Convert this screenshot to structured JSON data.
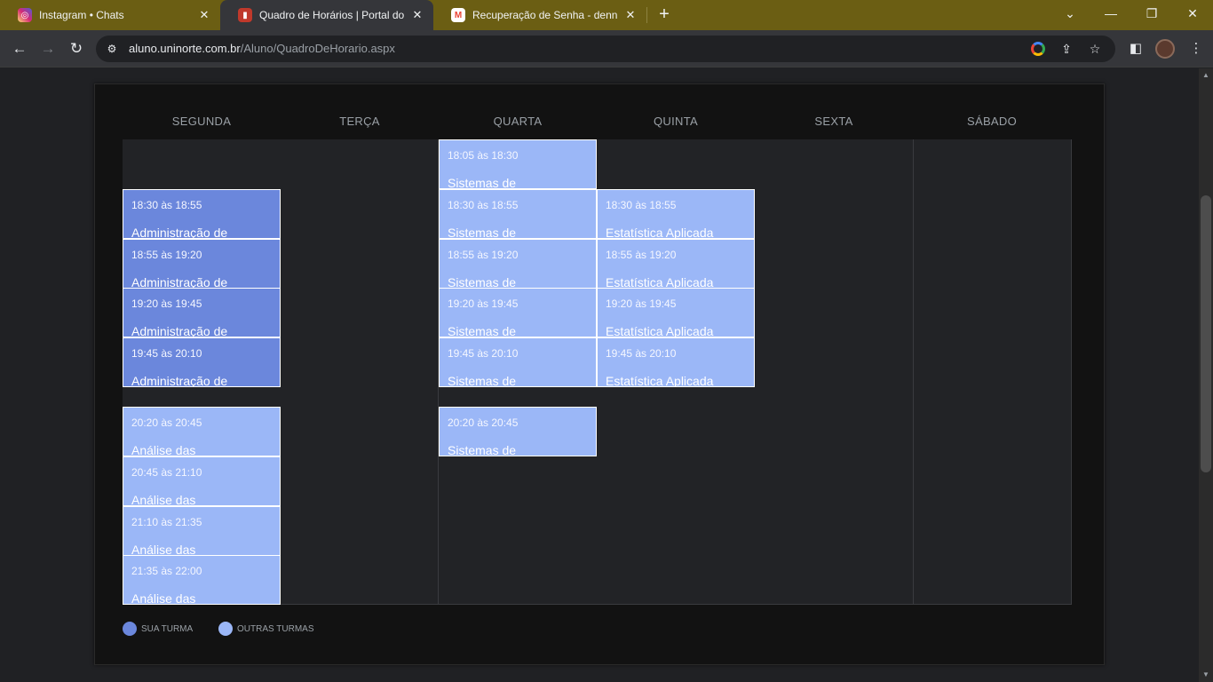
{
  "browser": {
    "tabs": [
      {
        "title": "Instagram • Chats",
        "icon": "instagram-icon"
      },
      {
        "title": "Quadro de Horários | Portal do Al",
        "icon": "uninorte-icon"
      },
      {
        "title": "Recuperação de Senha - dennelly",
        "icon": "gmail-icon"
      }
    ],
    "close_glyph": "✕",
    "new_tab_glyph": "+",
    "url_domain": "aluno.uninorte.com.br",
    "url_path": "/Aluno/QuadroDeHorario.aspx",
    "window_controls": {
      "dropdown": "⌄",
      "minimize": "—",
      "restore": "❐",
      "close": "✕"
    }
  },
  "schedule": {
    "days": [
      "SEGUNDA",
      "TERÇA",
      "QUARTA",
      "QUINTA",
      "SEXTA",
      "SÁBADO"
    ],
    "monday": [
      {
        "time": "18:30 às 18:55",
        "subject": "Administração de",
        "type": "mine"
      },
      {
        "time": "18:55 às 19:20",
        "subject": "Administração de",
        "type": "mine"
      },
      {
        "time": "19:20 às 19:45",
        "subject": "Administração de",
        "type": "mine"
      },
      {
        "time": "19:45 às 20:10",
        "subject": "Administração de",
        "type": "mine"
      },
      {
        "time": "20:20 às 20:45",
        "subject": "Análise das",
        "type": "other"
      },
      {
        "time": "20:45 às 21:10",
        "subject": "Análise das",
        "type": "other"
      },
      {
        "time": "21:10 às 21:35",
        "subject": "Análise das",
        "type": "other"
      },
      {
        "time": "21:35 às 22:00",
        "subject": "Análise das",
        "type": "other"
      }
    ],
    "wednesday": [
      {
        "time": "18:05 às 18:30",
        "subject": "Sistemas de",
        "type": "other"
      },
      {
        "time": "18:30 às 18:55",
        "subject": "Sistemas de",
        "type": "other"
      },
      {
        "time": "18:55 às 19:20",
        "subject": "Sistemas de",
        "type": "other"
      },
      {
        "time": "19:20 às 19:45",
        "subject": "Sistemas de",
        "type": "other"
      },
      {
        "time": "19:45 às 20:10",
        "subject": "Sistemas de",
        "type": "other"
      },
      {
        "time": "20:20 às 20:45",
        "subject": "Sistemas de",
        "type": "other"
      }
    ],
    "thursday": [
      {
        "time": "18:30 às 18:55",
        "subject": "Estatística Aplicada",
        "type": "other"
      },
      {
        "time": "18:55 às 19:20",
        "subject": "Estatística Aplicada",
        "type": "other"
      },
      {
        "time": "19:20 às 19:45",
        "subject": "Estatística Aplicada",
        "type": "other"
      },
      {
        "time": "19:45 às 20:10",
        "subject": "Estatística Aplicada",
        "type": "other"
      }
    ]
  },
  "legend": {
    "mine_label": "SUA TURMA",
    "other_label": "OUTRAS TURMAS",
    "mine_color": "#6b87dc",
    "other_color": "#9bb7f7"
  }
}
